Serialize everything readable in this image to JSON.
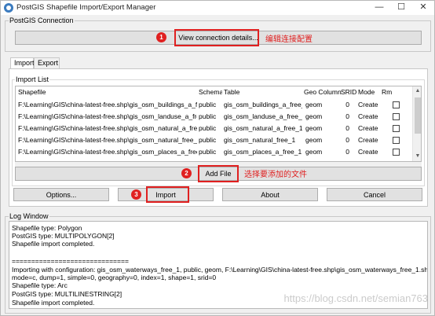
{
  "window": {
    "title": "PostGIS Shapefile Import/Export Manager",
    "controls": {
      "minimize": "—",
      "maximize": "☐",
      "close": "✕"
    }
  },
  "connection": {
    "group_title": "PostGIS Connection",
    "view_button": "View connection details..."
  },
  "tabs": [
    {
      "label": "Import",
      "active": true
    },
    {
      "label": "Export",
      "active": false
    }
  ],
  "import_list": {
    "group_title": "Import List",
    "columns": [
      "Shapefile",
      "Schema",
      "Table",
      "Geo Column",
      "SRID",
      "Mode",
      "Rm"
    ],
    "rows": [
      {
        "shapefile": "F:\\Learning\\GIS\\china-latest-free.shp\\gis_osm_buildings_a_free",
        "schema": "public",
        "table": "gis_osm_buildings_a_free_1",
        "geo_column": "geom",
        "srid": "0",
        "mode": "Create",
        "rm": false
      },
      {
        "shapefile": "F:\\Learning\\GIS\\china-latest-free.shp\\gis_osm_landuse_a_free_1",
        "schema": "public",
        "table": "gis_osm_landuse_a_free_1",
        "geo_column": "geom",
        "srid": "0",
        "mode": "Create",
        "rm": false
      },
      {
        "shapefile": "F:\\Learning\\GIS\\china-latest-free.shp\\gis_osm_natural_a_free_1.",
        "schema": "public",
        "table": "gis_osm_natural_a_free_1",
        "geo_column": "geom",
        "srid": "0",
        "mode": "Create",
        "rm": false
      },
      {
        "shapefile": "F:\\Learning\\GIS\\china-latest-free.shp\\gis_osm_natural_free_1.sh",
        "schema": "public",
        "table": "gis_osm_natural_free_1",
        "geo_column": "geom",
        "srid": "0",
        "mode": "Create",
        "rm": false
      },
      {
        "shapefile": "F:\\Learning\\GIS\\china-latest-free.shp\\gis_osm_places_a_free_1.:",
        "schema": "public",
        "table": "gis_osm_places_a_free_1",
        "geo_column": "geom",
        "srid": "0",
        "mode": "Create",
        "rm": false
      }
    ],
    "add_file_button": "Add File"
  },
  "actions": {
    "options": "Options...",
    "import": "Import",
    "about": "About",
    "cancel": "Cancel"
  },
  "log": {
    "group_title": "Log Window",
    "lines": [
      "Shapefile type: Polygon",
      "PostGIS type: MULTIPOLYGON[2]",
      "Shapefile import completed.",
      "",
      "==============================",
      "Importing with configuration: gis_osm_waterways_free_1, public, geom, F:\\Learning\\GIS\\china-latest-free.shp\\gis_osm_waterways_free_1.shp,",
      "mode=c, dump=1, simple=0, geography=0, index=1, shape=1, srid=0",
      "Shapefile type: Arc",
      "PostGIS type: MULTILINESTRING[2]",
      "Shapefile import completed."
    ]
  },
  "annotations": {
    "marker1": "1",
    "marker2": "2",
    "marker3": "3",
    "note1": "编辑连接配置",
    "note2": "选择要添加的文件",
    "color": "#e02020"
  },
  "watermark": "https://blog.csdn.net/semian763"
}
